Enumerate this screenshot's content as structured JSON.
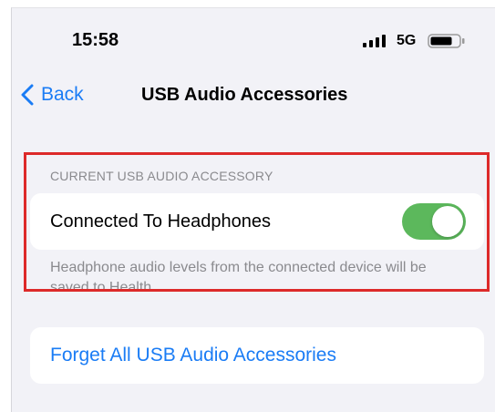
{
  "status_bar": {
    "time": "15:58",
    "network": "5G",
    "icons": [
      "signal-bars-icon",
      "battery-icon"
    ]
  },
  "nav": {
    "back_label": "Back",
    "title": "USB Audio Accessories",
    "back_icon": "chevron-left-icon"
  },
  "current_accessory": {
    "header": "CURRENT USB AUDIO ACCESSORY",
    "row_label": "Connected To Headphones",
    "toggle_on": true,
    "footer": "Headphone audio levels from the connected device will be saved to Health."
  },
  "forget": {
    "label": "Forget All USB Audio Accessories"
  },
  "colors": {
    "accent": "#1a7cf5",
    "toggle_on": "#5cb85c",
    "highlight": "#dd2a2a",
    "background": "#f2f2f7"
  }
}
